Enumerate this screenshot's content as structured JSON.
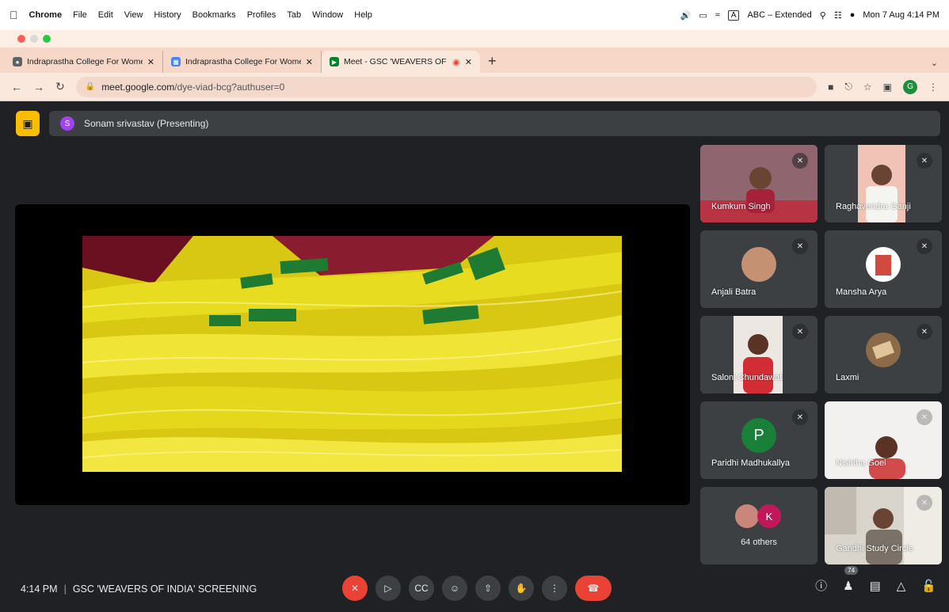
{
  "menubar": {
    "app": "Chrome",
    "items": [
      "File",
      "Edit",
      "View",
      "History",
      "Bookmarks",
      "Profiles",
      "Tab",
      "Window",
      "Help"
    ],
    "input_source": "ABC – Extended",
    "input_key": "A",
    "datetime": "Mon 7 Aug  4:14 PM"
  },
  "tabs": [
    {
      "label": "Indraprastha College For Wome",
      "icon": "globe-icon",
      "active": false
    },
    {
      "label": "Indraprastha College For Wome",
      "icon": "calendar-icon",
      "active": false
    },
    {
      "label": "Meet - GSC 'WEAVERS OF",
      "icon": "meet-icon",
      "active": true
    }
  ],
  "address": {
    "host": "meet.google.com",
    "path": "/dye-viad-bcg?authuser=0",
    "profile_initial": "G"
  },
  "presenter": {
    "initial": "S",
    "label": "Sonam srivastav (Presenting)"
  },
  "participants": [
    {
      "name": "Kumkum Singh",
      "kind": "video",
      "muted": true
    },
    {
      "name": "Raghavendra Ganji",
      "kind": "video",
      "muted": true
    },
    {
      "name": "Anjali Batra",
      "kind": "avatar",
      "muted": true
    },
    {
      "name": "Mansha Arya",
      "kind": "avatar",
      "muted": true
    },
    {
      "name": "Saloni Chundawat",
      "kind": "video",
      "muted": true
    },
    {
      "name": "Laxmi",
      "kind": "avatar",
      "muted": true
    },
    {
      "name": "Paridhi Madhukallya",
      "kind": "letter",
      "initial": "P",
      "muted": true
    },
    {
      "name": "Nishtha Goel",
      "kind": "video",
      "muted": true
    },
    {
      "name": "Gandhi Study Circle",
      "kind": "video",
      "muted": true
    }
  ],
  "others": {
    "label": "64 others",
    "initial": "K"
  },
  "meeting": {
    "time": "4:14 PM",
    "title": "GSC 'WEAVERS OF INDIA' SCREENING"
  },
  "participant_count": "74",
  "colors": {
    "accent_red": "#ea4335",
    "presenting_yellow": "#fbbc04",
    "meet_bg": "#202124"
  }
}
